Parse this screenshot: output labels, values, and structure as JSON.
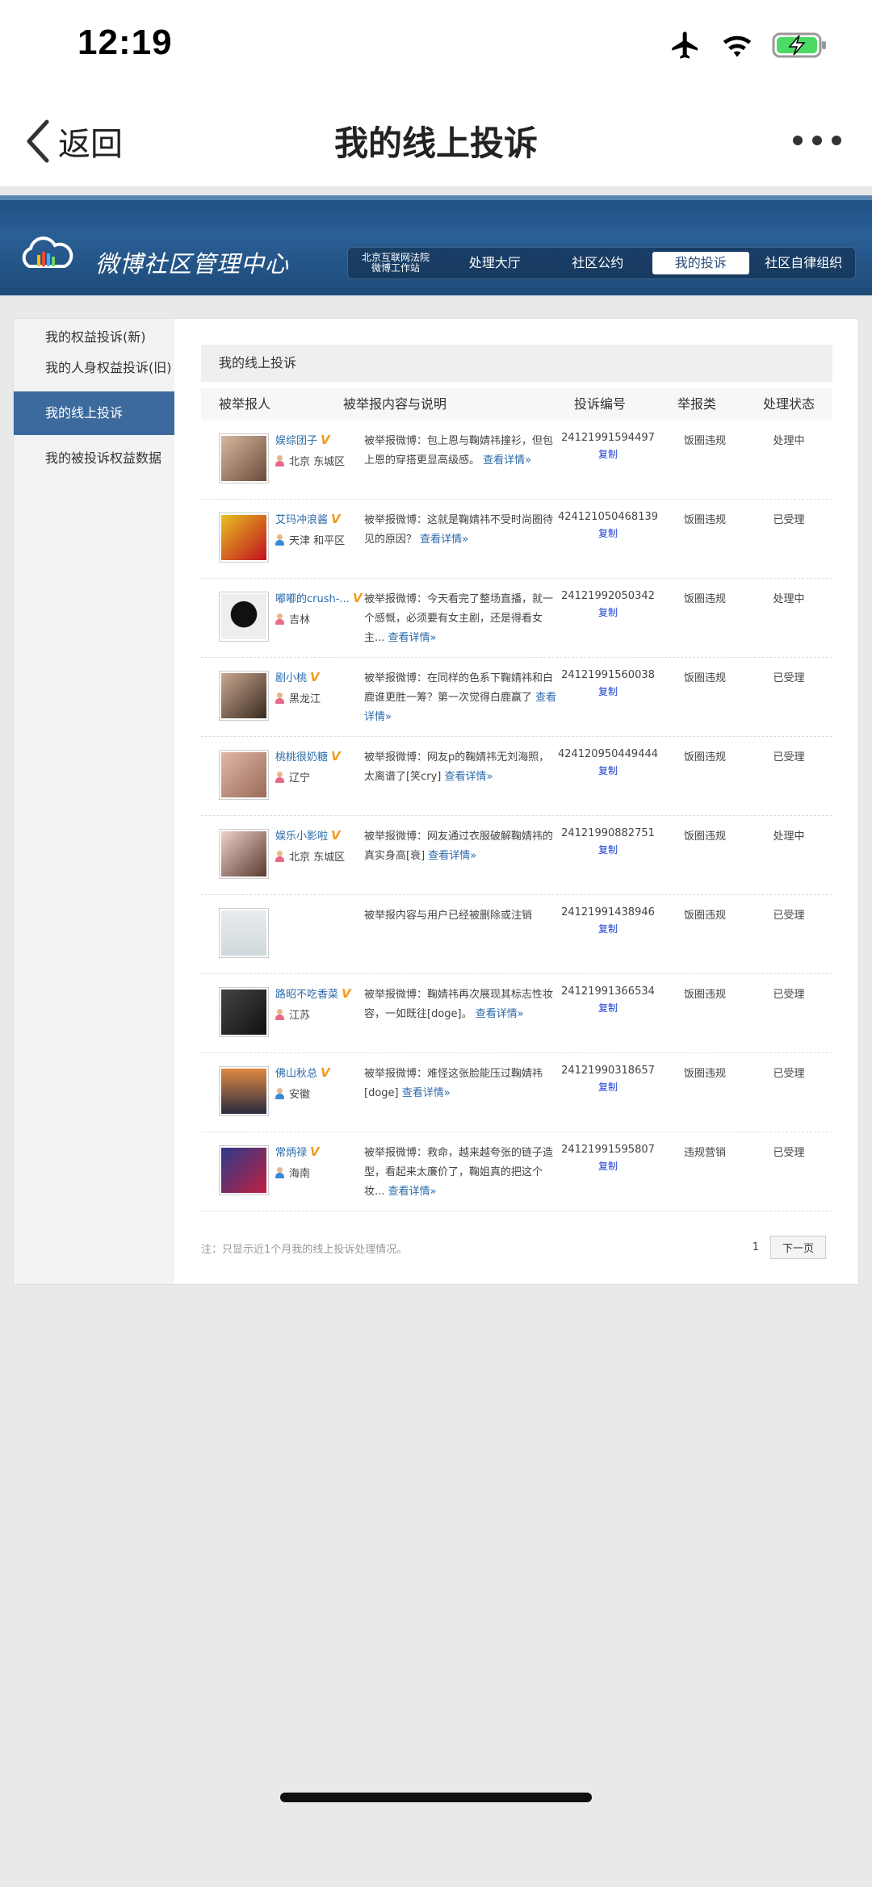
{
  "status": {
    "time": "12:19"
  },
  "nav": {
    "back_label": "返回",
    "title": "我的线上投诉"
  },
  "site": {
    "title": "微博社区管理中心",
    "court_line1": "北京互联网法院",
    "court_line2": "微博工作站",
    "menu": [
      "处理大厅",
      "社区公约",
      "我的投诉",
      "社区自律组织"
    ],
    "active_menu": "我的投诉"
  },
  "sidebar": {
    "items": [
      "我的权益投诉(新)",
      "我的人身权益投诉(旧)",
      "我的线上投诉",
      "我的被投诉权益数据"
    ]
  },
  "main": {
    "heading": "我的线上投诉",
    "columns": [
      "被举报人",
      "被举报内容与说明",
      "投诉编号",
      "举报类",
      "处理状态"
    ],
    "copy_label": "复制",
    "detail_label": "查看详情»",
    "rows": [
      {
        "name": "娱综团子",
        "location": "北京 东城区",
        "content": "被举报微博：包上恩与鞠婧祎撞衫，但包上恩的穿搭更显高级感。",
        "detail": "查看详情»",
        "id": "24121991594497",
        "category": "饭圈违规",
        "status": "处理中"
      },
      {
        "name": "艾玛冲浪酱",
        "location": "天津 和平区",
        "content": "被举报微博：这就是鞠婧祎不受时尚圈待见的原因？",
        "detail": "查看详情»",
        "id": "424121050468139",
        "category": "饭圈违规",
        "status": "已受理"
      },
      {
        "name": "嘟嘟的crush-...",
        "location": "吉林",
        "content": "被举报微博：今天看完了整场直播，就一个感慨，必须要有女主剧，还是得看女主...",
        "detail": "查看详情»",
        "id": "24121992050342",
        "category": "饭圈违规",
        "status": "处理中"
      },
      {
        "name": "剧小桃",
        "location": "黑龙江",
        "content": "被举报微博：在同样的色系下鞠婧祎和白鹿谁更胜一筹？第一次觉得白鹿赢了",
        "detail": "查看详情»",
        "id": "24121991560038",
        "category": "饭圈违规",
        "status": "已受理"
      },
      {
        "name": "桃桃很奶糖",
        "location": "辽宁",
        "content": "被举报微博：网友p的鞠婧祎无刘海照，太离谱了[笑cry]",
        "detail": "查看详情»",
        "id": "424120950449444",
        "category": "饭圈违规",
        "status": "已受理"
      },
      {
        "name": "娱乐小影啦",
        "location": "北京 东城区",
        "content": "被举报微博：网友通过衣服破解鞠婧祎的真实身高[衰]",
        "detail": "查看详情»",
        "id": "24121990882751",
        "category": "饭圈违规",
        "status": "处理中"
      },
      {
        "name": "",
        "location": "",
        "content": "被举报内容与用户已经被删除或注销",
        "detail": "",
        "id": "24121991438946",
        "category": "饭圈违规",
        "status": "已受理"
      },
      {
        "name": "路昭不吃香菜",
        "location": "江苏",
        "content": "被举报微博：鞠婧祎再次展现其标志性妆容，一如既往[doge]。",
        "detail": "查看详情»",
        "id": "24121991366534",
        "category": "饭圈违规",
        "status": "已受理"
      },
      {
        "name": "佛山秋总",
        "location": "安徽",
        "content": "被举报微博：难怪这张脸能压过鞠婧祎[doge]",
        "detail": "查看详情»",
        "id": "24121990318657",
        "category": "饭圈违规",
        "status": "已受理"
      },
      {
        "name": "常炳禄",
        "location": "海南",
        "content": "被举报微博：救命，越来越夸张的链子造型，看起来太廉价了，鞠姐真的把这个妆...",
        "detail": "查看详情»",
        "id": "24121991595807",
        "category": "违规营销",
        "status": "已受理"
      }
    ]
  },
  "footer": {
    "note": "注：只显示近1个月我的线上投诉处理情况。",
    "page": "1",
    "next": "下一页"
  },
  "colors": {
    "header_blue": "#2a5f95",
    "sidebar_active": "#3c6a9c",
    "link": "#2b6aaa",
    "copy": "#1a3fd0",
    "vip": "#f39a1c"
  }
}
